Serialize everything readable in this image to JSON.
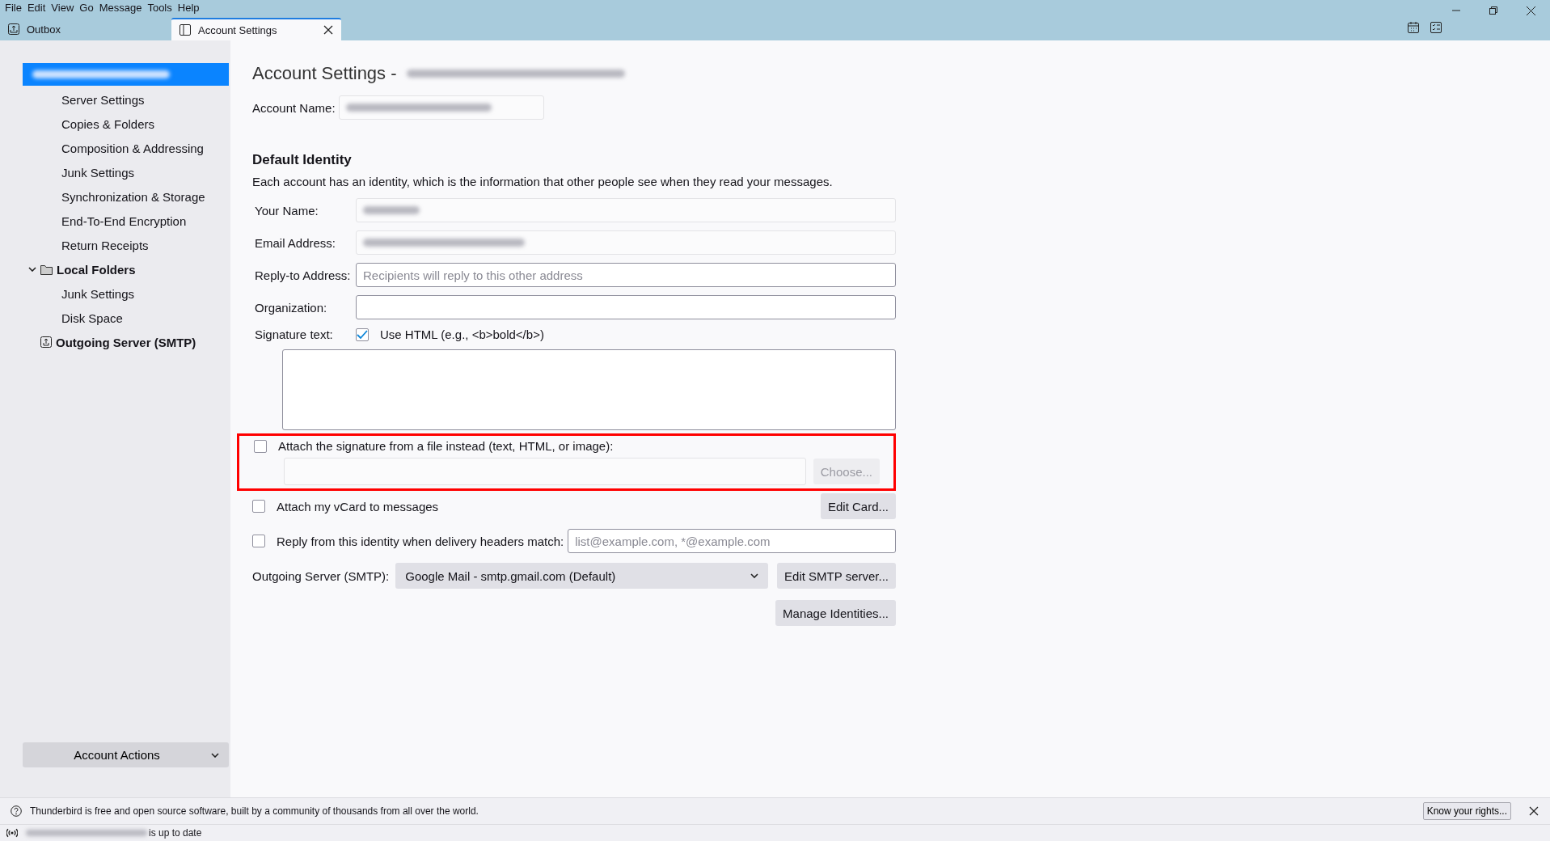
{
  "menu_bar": [
    {
      "label": "File"
    },
    {
      "label": "Edit"
    },
    {
      "label": "View"
    },
    {
      "label": "Go"
    },
    {
      "label": "Message"
    },
    {
      "label": "Tools"
    },
    {
      "label": "Help"
    }
  ],
  "tabs": [
    {
      "label": "Outbox",
      "selected": false,
      "kind": "folder"
    },
    {
      "label": "Account Settings",
      "selected": true,
      "kind": "settings"
    }
  ],
  "sidebar": {
    "tree": [
      {
        "kind": "account",
        "selected": true,
        "children": [
          {
            "label": "Server Settings",
            "selected": false
          },
          {
            "label": "Copies & Folders",
            "selected": false
          },
          {
            "label": "Composition & Addressing",
            "selected": false
          },
          {
            "label": "Junk Settings",
            "selected": false
          },
          {
            "label": "Synchronization & Storage",
            "selected": false
          },
          {
            "label": "End-To-End Encryption",
            "selected": false
          },
          {
            "label": "Return Receipts",
            "selected": false
          }
        ]
      },
      {
        "kind": "folder",
        "label": "Local Folders",
        "selected": false,
        "expanded": true,
        "children": [
          {
            "label": "Junk Settings",
            "selected": false
          },
          {
            "label": "Disk Space",
            "selected": false
          }
        ]
      },
      {
        "kind": "smtp",
        "label": "Outgoing Server (SMTP)",
        "selected": false
      }
    ],
    "account_actions": "Account Actions"
  },
  "settings": {
    "title": "Account Settings -",
    "account_name_label": "Account Name:",
    "section_title": "Default Identity",
    "description": "Each account has an identity, which is the information that other people see when they read your messages.",
    "fields": [
      {
        "label": "Your Name:",
        "kind": "blurred"
      },
      {
        "label": "Email Address:",
        "kind": "blurred"
      },
      {
        "label": "Reply-to Address:",
        "kind": "text",
        "placeholder": "Recipients will reply to this other address"
      },
      {
        "label": "Organization:",
        "kind": "text"
      }
    ],
    "signature": {
      "label": "Signature text:",
      "use_html_label": "Use HTML (e.g., <b>bold</b>)",
      "use_html_checked": true
    },
    "attach_signature": {
      "label": "Attach the signature from a file instead (text, HTML, or image):",
      "checked": false,
      "highlighted": true,
      "button": "Choose...",
      "button_disabled": true
    },
    "vcard": {
      "label": "Attach my vCard to messages",
      "checked": false,
      "button": "Edit Card..."
    },
    "reply_match": {
      "label": "Reply from this identity when delivery headers match:",
      "checked": false,
      "placeholder": "list@example.com, *@example.com"
    },
    "smtp": {
      "label": "Outgoing Server (SMTP):",
      "value": "Google Mail - smtp.gmail.com (Default)",
      "button": "Edit SMTP server..."
    },
    "manage_button": "Manage Identities..."
  },
  "notification": {
    "text": "Thunderbird is free and open source software, built by a community of thousands from all over the world.",
    "button": "Know your rights..."
  },
  "status_bar": {
    "text": "is up to date"
  }
}
